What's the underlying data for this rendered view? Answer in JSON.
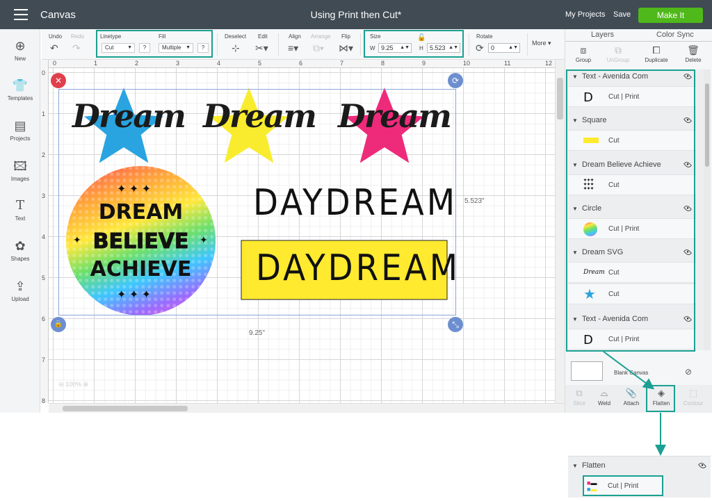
{
  "topbar": {
    "app_title": "Canvas",
    "document_title": "Using Print then Cut*",
    "my_projects": "My Projects",
    "save": "Save",
    "make_it": "Make It"
  },
  "toolbar": {
    "undo": "Undo",
    "redo": "Redo",
    "linetype_label": "Linetype",
    "linetype_value": "Cut",
    "fill_label": "Fill",
    "fill_value": "Multiple",
    "help": "?",
    "deselect": "Deselect",
    "edit": "Edit",
    "align": "Align",
    "arrange": "Arrange",
    "flip": "Flip",
    "size_label": "Size",
    "width_prefix": "W",
    "width_value": "9.25",
    "height_prefix": "H",
    "height_value": "5.523",
    "rotate_label": "Rotate",
    "rotate_value": "0",
    "more": "More"
  },
  "left_nav": [
    {
      "label": "New",
      "icon": "plus-circle-icon"
    },
    {
      "label": "Templates",
      "icon": "shirt-icon"
    },
    {
      "label": "Projects",
      "icon": "projects-icon"
    },
    {
      "label": "Images",
      "icon": "image-icon"
    },
    {
      "label": "Text",
      "icon": "text-icon"
    },
    {
      "label": "Shapes",
      "icon": "shapes-icon"
    },
    {
      "label": "Upload",
      "icon": "upload-icon"
    }
  ],
  "ruler": {
    "top": [
      "0",
      "1",
      "2",
      "3",
      "4",
      "5",
      "6",
      "7",
      "8",
      "9",
      "10",
      "11",
      "12"
    ],
    "left": [
      "0",
      "1",
      "2",
      "3",
      "4",
      "5",
      "6",
      "7",
      "8"
    ]
  },
  "canvas": {
    "dream_text": "Dream",
    "dream_star_colors": [
      "#29a4e0",
      "#f9ec2e",
      "#ee2a7b"
    ],
    "circle_words": [
      "DREAM",
      "BELIEVE",
      "ACHIEVE"
    ],
    "daydream_plain": "DAYDREAM",
    "daydream_box": "DAYDREAM",
    "daydream_box_color": "#ffea2f",
    "width_label": "9.25\"",
    "height_label": "5.523\"",
    "zoom": "100%"
  },
  "right_panel": {
    "tabs": [
      "Layers",
      "Color Sync"
    ],
    "actions": [
      "Group",
      "UnGroup",
      "Duplicate",
      "Delete"
    ],
    "layers": [
      {
        "name": "Text - Avenida Com",
        "rows": [
          {
            "op": "Cut  |  Print"
          }
        ]
      },
      {
        "name": "Square",
        "rows": [
          {
            "op": "Cut"
          }
        ]
      },
      {
        "name": "Dream Believe Achieve",
        "rows": [
          {
            "op": "Cut"
          }
        ]
      },
      {
        "name": "Circle",
        "rows": [
          {
            "op": "Cut  |  Print"
          }
        ]
      },
      {
        "name": "Dream SVG",
        "rows": [
          {
            "op": "Cut"
          },
          {
            "op": "Cut"
          }
        ]
      },
      {
        "name": "Text - Avenida Com",
        "rows": [
          {
            "op": "Cut  |  Print"
          }
        ]
      }
    ],
    "blank_canvas": "Blank Canvas",
    "bottom_actions": [
      "Slice",
      "Weld",
      "Attach",
      "Flatten",
      "Contour"
    ]
  },
  "callout": {
    "layer_name": "Flatten",
    "op": "Cut  |  Print"
  },
  "colors": {
    "accent_teal": "#1aa092",
    "make_it_green": "#4fb81a",
    "topbar": "#414b54"
  }
}
